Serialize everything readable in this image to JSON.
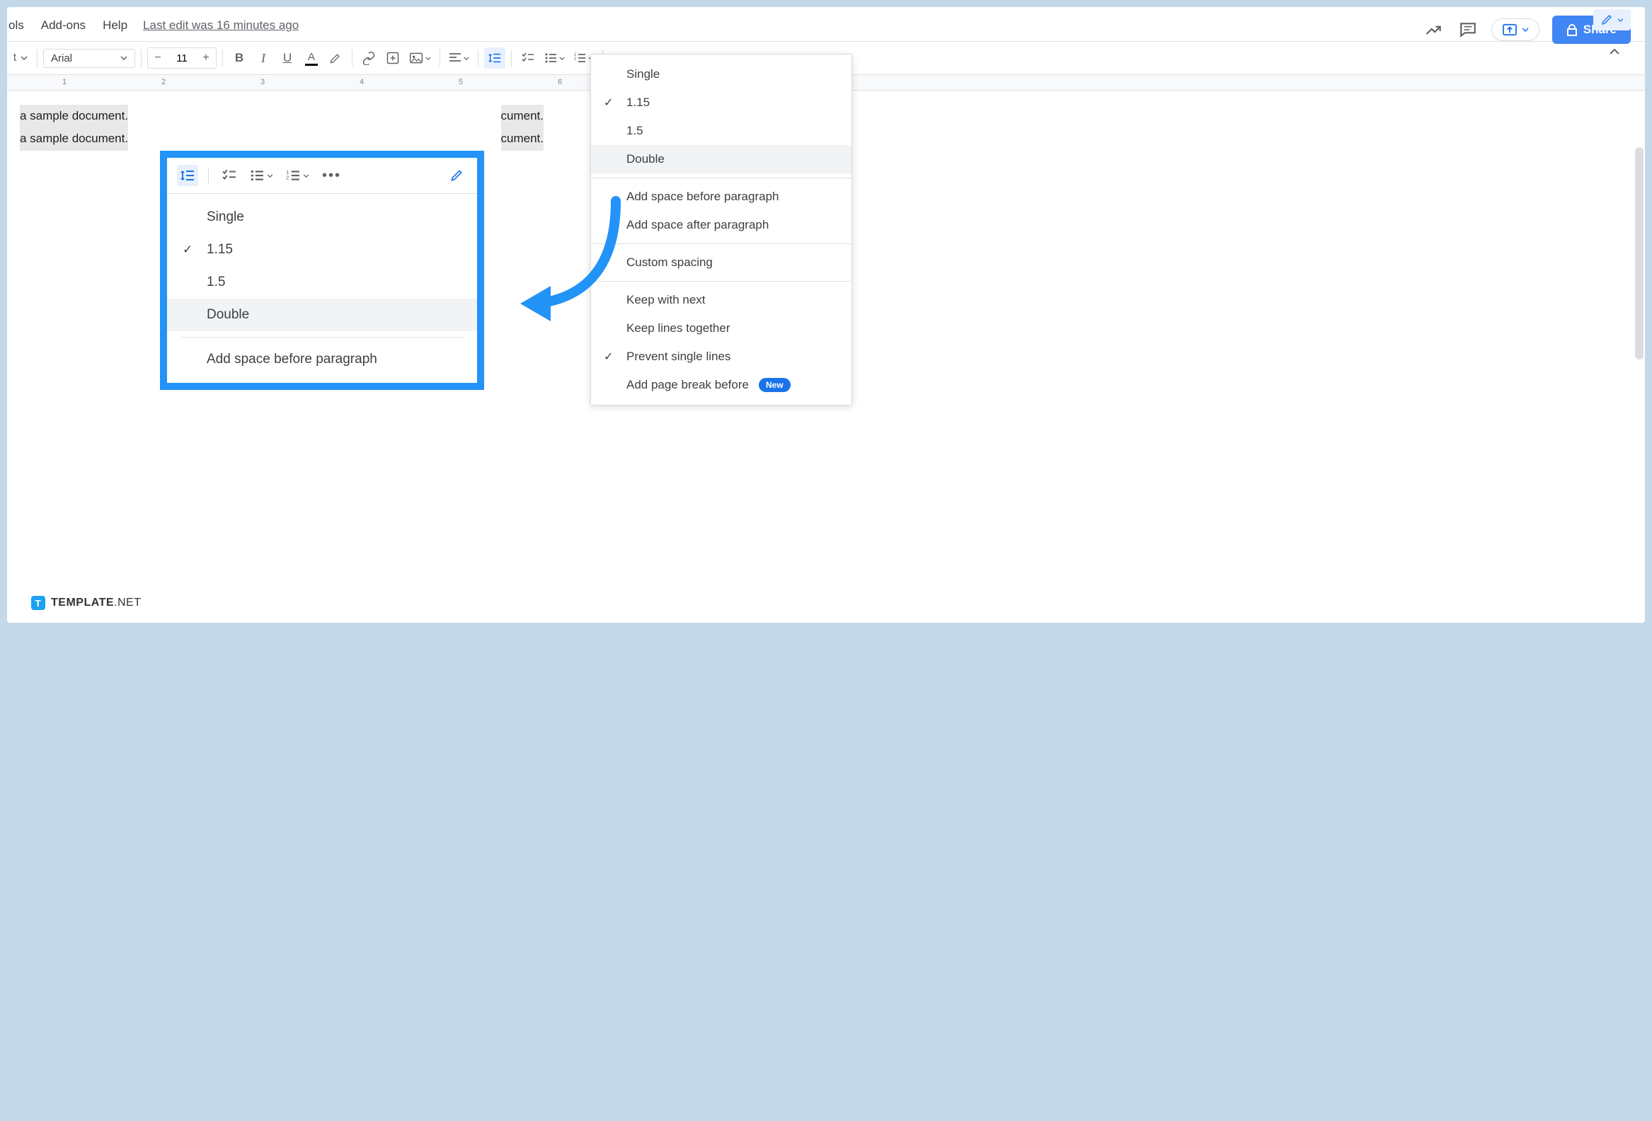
{
  "menu": {
    "tools": "ols",
    "addons": "Add-ons",
    "help": "Help",
    "last_edit": "Last edit was 16 minutes ago"
  },
  "top_right": {
    "share": "Share"
  },
  "toolbar": {
    "style_label": "t",
    "font_label": "Arial",
    "font_size": "11"
  },
  "ruler": {
    "marks": [
      "1",
      "2",
      "3",
      "4",
      "5",
      "6"
    ]
  },
  "doc": {
    "line1_left": "a sample document.",
    "line1_right": "cument.",
    "line2_left": "a sample document.",
    "line2_right": "cument."
  },
  "dropdown": {
    "single": "Single",
    "o115": "1.15",
    "o15": "1.5",
    "double": "Double",
    "space_before": "Add space before paragraph",
    "space_after": "Add space after paragraph",
    "custom": "Custom spacing",
    "keep_next": "Keep with next",
    "keep_lines": "Keep lines together",
    "prevent_single": "Prevent single lines",
    "page_break": "Add page break before",
    "new_badge": "New"
  },
  "callout": {
    "single": "Single",
    "o115": "1.15",
    "o15": "1.5",
    "double": "Double",
    "space_before": "Add space before paragraph"
  },
  "watermark": {
    "text": "TEMPLATE",
    "net": ".NET"
  }
}
